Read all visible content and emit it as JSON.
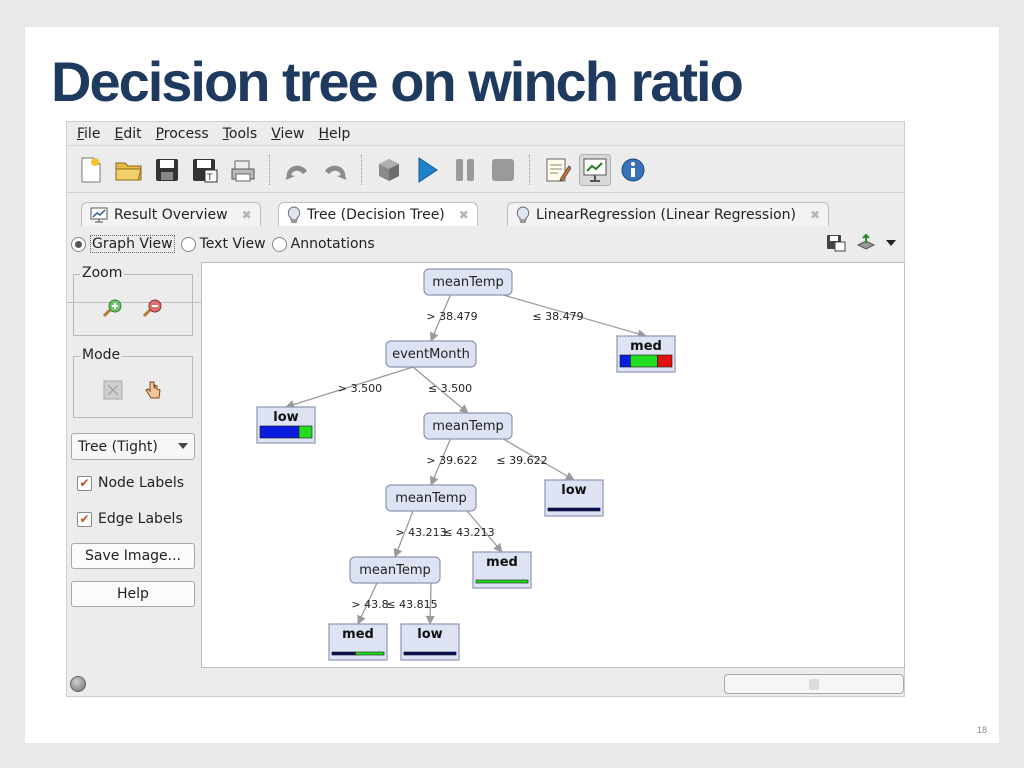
{
  "slide": {
    "title": "Decision tree on winch ratio",
    "page_number": "18"
  },
  "menu": [
    "File",
    "Edit",
    "Process",
    "Tools",
    "View",
    "Help"
  ],
  "menu_mnemonics": [
    "F",
    "E",
    "P",
    "T",
    "V",
    "H"
  ],
  "toolbar_icons": [
    "new-process-icon",
    "open-icon",
    "save-icon",
    "save-as-icon",
    "print-icon",
    "undo-icon",
    "redo-icon",
    "cube-icon",
    "run-icon",
    "pause-icon",
    "stop-icon",
    "design-perspective-icon",
    "result-perspective-icon",
    "info-icon"
  ],
  "tabs": [
    {
      "label": "Result Overview",
      "icon": "result-overview-icon"
    },
    {
      "label": "Tree (Decision Tree)",
      "icon": "bulb-icon"
    },
    {
      "label": "LinearRegression (Linear Regression)",
      "icon": "bulb-icon"
    }
  ],
  "view_modes": {
    "graph": "Graph View",
    "text": "Text View",
    "annotations": "Annotations",
    "selected": "Graph View"
  },
  "left_panel": {
    "zoom_label": "Zoom",
    "mode_label": "Mode",
    "layout_select": "Tree (Tight)",
    "node_labels": "Node Labels",
    "edge_labels": "Edge Labels",
    "node_labels_checked": true,
    "edge_labels_checked": true,
    "save_image": "Save Image...",
    "help": "Help"
  },
  "colors": {
    "node_fill": "#dde3f3",
    "node_stroke": "#8b97b3",
    "blue": "#0a1cde",
    "green": "#22dd22",
    "red": "#e01010",
    "navy": "#0a1060",
    "title": "#1e3a5f"
  },
  "tree": {
    "nodes": [
      {
        "id": "n1",
        "label": "meanTemp",
        "type": "split"
      },
      {
        "id": "n2",
        "label": "eventMonth",
        "type": "split"
      },
      {
        "id": "n3",
        "label": "med",
        "type": "leaf",
        "dist": [
          {
            "c": "blue",
            "v": 0.2
          },
          {
            "c": "green",
            "v": 0.52
          },
          {
            "c": "red",
            "v": 0.28
          }
        ]
      },
      {
        "id": "n4",
        "label": "low",
        "type": "leaf",
        "dist": [
          {
            "c": "blue",
            "v": 0.75
          },
          {
            "c": "green",
            "v": 0.25
          }
        ]
      },
      {
        "id": "n5",
        "label": "meanTemp",
        "type": "split"
      },
      {
        "id": "n6",
        "label": "meanTemp",
        "type": "split"
      },
      {
        "id": "n7",
        "label": "low",
        "type": "leaf",
        "dist": [
          {
            "c": "navy",
            "v": 1.0
          }
        ]
      },
      {
        "id": "n8",
        "label": "meanTemp",
        "type": "split"
      },
      {
        "id": "n9",
        "label": "med",
        "type": "leaf",
        "dist": [
          {
            "c": "green",
            "v": 1.0
          }
        ]
      },
      {
        "id": "n10",
        "label": "med",
        "type": "leaf",
        "dist": [
          {
            "c": "navy",
            "v": 0.45
          },
          {
            "c": "green",
            "v": 0.55
          }
        ]
      },
      {
        "id": "n11",
        "label": "low",
        "type": "leaf",
        "dist": [
          {
            "c": "navy",
            "v": 1.0
          }
        ]
      }
    ],
    "edges": [
      {
        "from": "n1",
        "to": "n2",
        "label": "> 38.479"
      },
      {
        "from": "n1",
        "to": "n3",
        "label": "≤ 38.479"
      },
      {
        "from": "n2",
        "to": "n4",
        "label": "> 3.500"
      },
      {
        "from": "n2",
        "to": "n5",
        "label": "≤ 3.500"
      },
      {
        "from": "n5",
        "to": "n6",
        "label": "> 39.622"
      },
      {
        "from": "n5",
        "to": "n7",
        "label": "≤ 39.622"
      },
      {
        "from": "n6",
        "to": "n8",
        "label": "> 43.213"
      },
      {
        "from": "n6",
        "to": "n9",
        "label": "≤ 43.213"
      },
      {
        "from": "n8",
        "to": "n10",
        "label": "> 43.8"
      },
      {
        "from": "n8",
        "to": "n11",
        "label": "≤ 43.815"
      }
    ]
  }
}
